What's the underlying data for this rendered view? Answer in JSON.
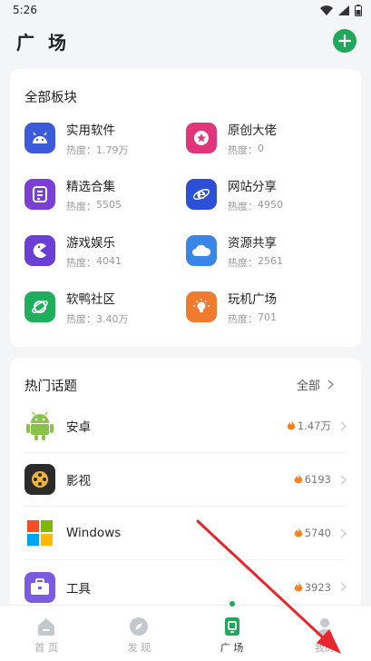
{
  "status_bar": {
    "time": "5:26"
  },
  "header": {
    "title": "广 场"
  },
  "boards": {
    "title": "全部板块",
    "items": [
      {
        "name": "实用软件",
        "heat_label": "热度：",
        "heat": "1.79万",
        "icon": "android-icon",
        "color": "#3b5bdb"
      },
      {
        "name": "原创大佬",
        "heat_label": "热度：",
        "heat": "0",
        "icon": "star-badge-icon",
        "color": "#e0357a"
      },
      {
        "name": "精选合集",
        "heat_label": "热度：",
        "heat": "5505",
        "icon": "collection-icon",
        "color": "#7b3fd6"
      },
      {
        "name": "网站分享",
        "heat_label": "热度：",
        "heat": "4950",
        "icon": "browser-e-icon",
        "color": "#2c4fd6"
      },
      {
        "name": "游戏娱乐",
        "heat_label": "热度：",
        "heat": "4041",
        "icon": "pacman-icon",
        "color": "#6a3fd6"
      },
      {
        "name": "资源共享",
        "heat_label": "热度：",
        "heat": "2561",
        "icon": "cloud-icon",
        "color": "#3a86e8"
      },
      {
        "name": "软鸭社区",
        "heat_label": "热度：",
        "heat": "3.40万",
        "icon": "planet-icon",
        "color": "#1fae5b"
      },
      {
        "name": "玩机广场",
        "heat_label": "热度：",
        "heat": "701",
        "icon": "bulb-icon",
        "color": "#f07a2e"
      }
    ]
  },
  "topics": {
    "title": "热门话题",
    "all_label": "全部",
    "items": [
      {
        "name": "安卓",
        "heat": "1.47万",
        "icon": "android-robot-icon"
      },
      {
        "name": "影视",
        "heat": "6193",
        "icon": "film-reel-icon"
      },
      {
        "name": "Windows",
        "heat": "5740",
        "icon": "windows-logo-icon"
      },
      {
        "name": "工具",
        "heat": "3923",
        "icon": "toolbox-icon"
      }
    ]
  },
  "bottom_nav": {
    "items": [
      {
        "label": "首 页",
        "icon": "home-icon"
      },
      {
        "label": "发 现",
        "icon": "compass-icon"
      },
      {
        "label": "广 场",
        "icon": "square-card-icon",
        "active": true
      },
      {
        "label": "我的",
        "icon": "user-icon"
      }
    ]
  },
  "colors": {
    "accent": "#1fa85a",
    "arrow": "#e8262b"
  }
}
